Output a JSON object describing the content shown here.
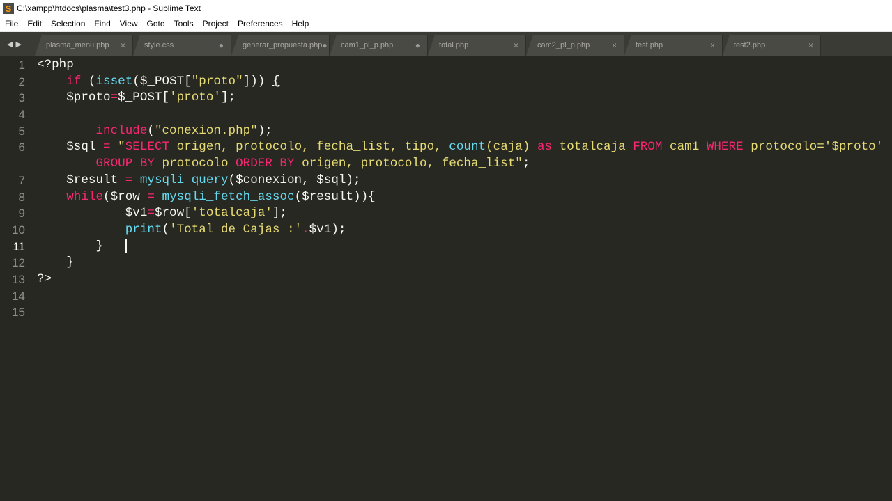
{
  "window": {
    "title": "C:\\xampp\\htdocs\\plasma\\test3.php - Sublime Text"
  },
  "menu": [
    "File",
    "Edit",
    "Selection",
    "Find",
    "View",
    "Goto",
    "Tools",
    "Project",
    "Preferences",
    "Help"
  ],
  "tabs": [
    {
      "label": "plasma_menu.php",
      "state": "×"
    },
    {
      "label": "style.css",
      "state": "●"
    },
    {
      "label": "generar_propuesta.php",
      "state": "●"
    },
    {
      "label": "cam1_pl_p.php",
      "state": "●"
    },
    {
      "label": "total.php",
      "state": "×"
    },
    {
      "label": "cam2_pl_p.php",
      "state": "×"
    },
    {
      "label": "test.php",
      "state": "×"
    },
    {
      "label": "test2.php",
      "state": "×"
    }
  ],
  "colors": {
    "background": "#272822",
    "keyword": "#f92672",
    "function": "#66d9ef",
    "string": "#e6db74",
    "text": "#f8f8f2"
  },
  "current_line": 11,
  "lines": [
    {
      "n": "1",
      "tokens": [
        [
          "<?php",
          ""
        ]
      ]
    },
    {
      "n": "2",
      "tokens": [
        [
          "    ",
          ""
        ],
        [
          "if",
          "kw"
        ],
        [
          " (",
          ""
        ],
        [
          "isset",
          "fn"
        ],
        [
          "($_POST[",
          ""
        ],
        [
          "\"proto\"",
          "str"
        ],
        [
          "])) ",
          ""
        ],
        [
          "{",
          "ul"
        ]
      ]
    },
    {
      "n": "3",
      "tokens": [
        [
          "    $proto",
          ""
        ],
        [
          "=",
          "kw"
        ],
        [
          "$_POST[",
          ""
        ],
        [
          "'proto'",
          "str"
        ],
        [
          "];",
          ""
        ]
      ]
    },
    {
      "n": "4",
      "tokens": []
    },
    {
      "n": "5",
      "tokens": [
        [
          "        ",
          ""
        ],
        [
          "include",
          "kw"
        ],
        [
          "(",
          ""
        ],
        [
          "\"conexion.php\"",
          "str"
        ],
        [
          ");",
          ""
        ]
      ]
    },
    {
      "n": "6",
      "tokens": [
        [
          "    $sql ",
          ""
        ],
        [
          "=",
          "kw"
        ],
        [
          " ",
          ""
        ],
        [
          "\"",
          "str"
        ],
        [
          "SELECT",
          "kw"
        ],
        [
          " origen, protocolo, fecha_list, tipo, ",
          "str"
        ],
        [
          "count",
          "fn"
        ],
        [
          "(caja) ",
          "str"
        ],
        [
          "as",
          "kw"
        ],
        [
          " totalcaja ",
          "str"
        ],
        [
          "FROM",
          "kw"
        ],
        [
          " cam1 ",
          "str"
        ],
        [
          "WHERE",
          "kw"
        ],
        [
          " protocolo='$proto'",
          "str"
        ]
      ]
    },
    {
      "n": "",
      "tokens": [
        [
          "        ",
          ""
        ],
        [
          "GROUP BY",
          "kw"
        ],
        [
          " protocolo ",
          "str"
        ],
        [
          "ORDER BY",
          "kw"
        ],
        [
          " origen, protocolo, fecha_list\"",
          "str"
        ],
        [
          ";",
          ""
        ]
      ]
    },
    {
      "n": "7",
      "tokens": [
        [
          "    $result ",
          ""
        ],
        [
          "=",
          "kw"
        ],
        [
          " ",
          ""
        ],
        [
          "mysqli_query",
          "fn"
        ],
        [
          "($conexion, $sql);",
          ""
        ]
      ]
    },
    {
      "n": "8",
      "tokens": [
        [
          "    ",
          ""
        ],
        [
          "while",
          "kw"
        ],
        [
          "($row ",
          ""
        ],
        [
          "=",
          "kw"
        ],
        [
          " ",
          ""
        ],
        [
          "mysqli_fetch_assoc",
          "fn"
        ],
        [
          "($result)){",
          ""
        ]
      ]
    },
    {
      "n": "9",
      "tokens": [
        [
          "            $v1",
          ""
        ],
        [
          "=",
          "kw"
        ],
        [
          "$row[",
          ""
        ],
        [
          "'totalcaja'",
          "str"
        ],
        [
          "];",
          ""
        ]
      ]
    },
    {
      "n": "10",
      "tokens": [
        [
          "            ",
          ""
        ],
        [
          "print",
          "fn"
        ],
        [
          "(",
          ""
        ],
        [
          "'Total de Cajas :'",
          "str"
        ],
        [
          ".",
          "kw"
        ],
        [
          "$v1);",
          ""
        ]
      ]
    },
    {
      "n": "11",
      "tokens": [
        [
          "        }   ",
          ""
        ]
      ],
      "cursor": true
    },
    {
      "n": "12",
      "tokens": [
        [
          "    }",
          ""
        ]
      ]
    },
    {
      "n": "13",
      "tokens": [
        [
          "?>",
          ""
        ]
      ]
    },
    {
      "n": "14",
      "tokens": []
    },
    {
      "n": "15",
      "tokens": []
    }
  ]
}
